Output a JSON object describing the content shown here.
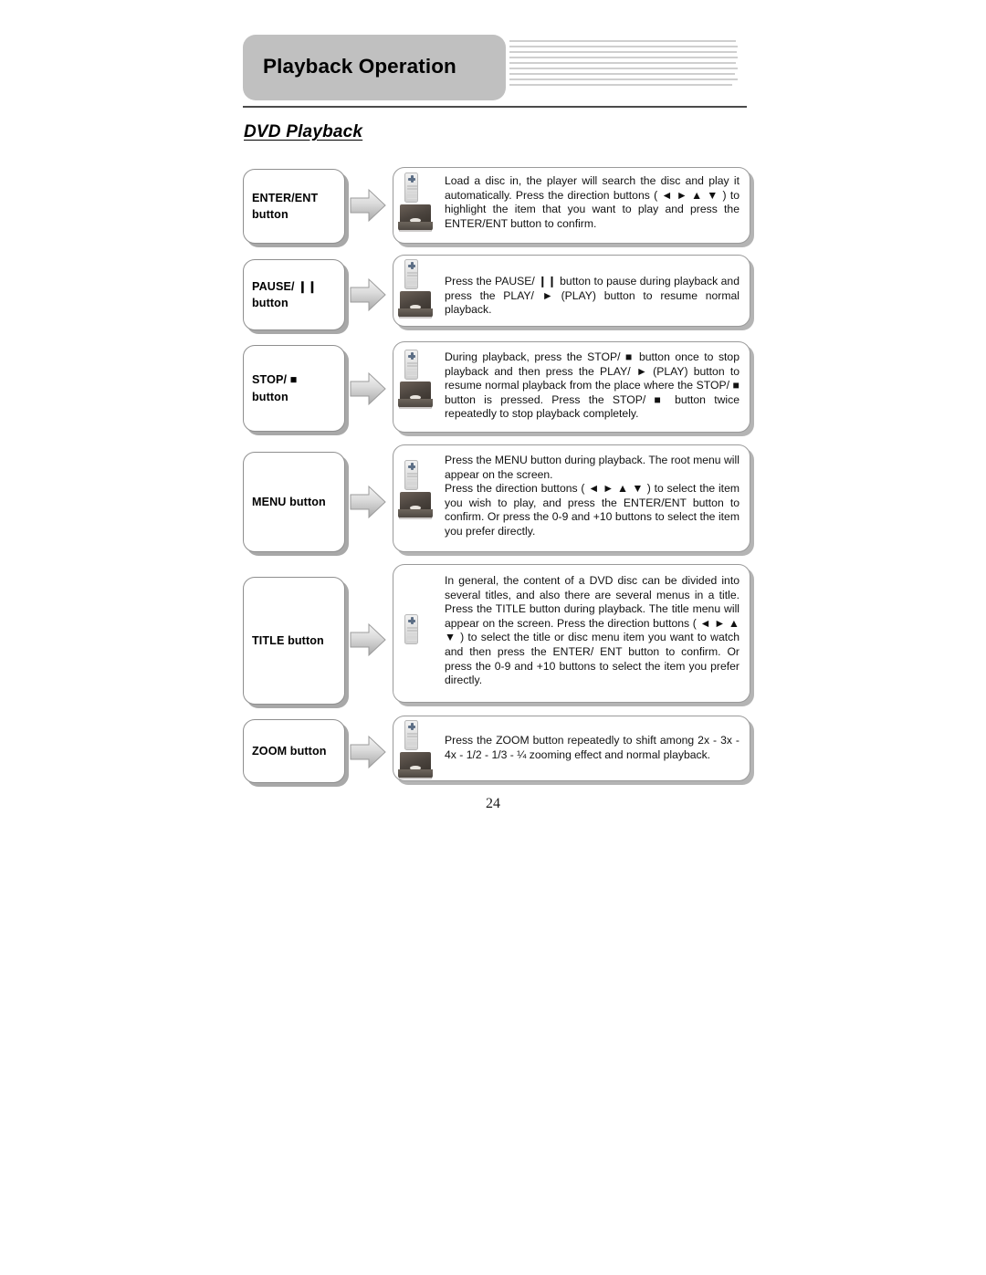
{
  "header": {
    "title": "Playback Operation",
    "stripe_count": 9
  },
  "section": {
    "heading": "DVD Playback"
  },
  "rows": [
    {
      "label": "ENTER/ENT button",
      "label_line1": "ENTER/ENT",
      "label_line2": "button",
      "icons": [
        "remote-icon",
        "dvd-player-icon"
      ],
      "text": "Load a disc in, the player will search the disc and play it automatically. Press the direction buttons ( ◄ ► ▲ ▼ ) to highlight the item that you want to play and press the ENTER/ENT button to confirm."
    },
    {
      "label": "PAUSE/ ❙❙ button",
      "label_line1": "PAUSE/ ❙❙",
      "label_line2": "button",
      "icons": [
        "remote-icon",
        "dvd-player-icon"
      ],
      "text": "Press the PAUSE/ ❙❙ button to pause during playback and press the PLAY/ ► (PLAY) button to resume normal playback."
    },
    {
      "label": "STOP/ ■ button",
      "label_line1": "STOP/ ■ button",
      "label_line2": "",
      "icons": [
        "remote-icon",
        "dvd-player-icon"
      ],
      "text": "During playback, press the STOP/ ■ button once to stop playback and then press the PLAY/ ► (PLAY) button to resume normal playback from the place where the STOP/ ■ button is pressed. Press the STOP/ ■ button twice repeatedly to stop playback completely."
    },
    {
      "label": "MENU button",
      "label_line1": "MENU button",
      "label_line2": "",
      "icons": [
        "remote-icon",
        "dvd-player-icon"
      ],
      "text": "Press the MENU button during playback. The root menu will appear on the screen.",
      "text2": "Press the direction buttons ( ◄ ► ▲ ▼ ) to select the item you wish to play, and press the ENTER/ENT button to confirm. Or press the 0-9 and +10 buttons to select the item you prefer directly."
    },
    {
      "label": "TITLE button",
      "label_line1": "TITLE button",
      "label_line2": "",
      "icons": [
        "remote-icon"
      ],
      "text": "In general, the content of a DVD disc can be divided into several titles, and also there are several menus in a title. Press the TITLE button during playback. The title menu will appear on the screen. Press the direction buttons ( ◄ ► ▲ ▼ ) to select the title or disc menu item you want to watch and then press the ENTER/ ENT button to confirm. Or press the 0-9 and +10 buttons to select the item you prefer directly."
    },
    {
      "label": "ZOOM button",
      "label_line1": "ZOOM button",
      "label_line2": "",
      "icons": [
        "remote-icon",
        "dvd-player-icon"
      ],
      "text": "Press the ZOOM button repeatedly to shift among 2x - 3x - 4x - 1/2 - 1/3 - ¼ zooming effect and normal playback."
    }
  ],
  "footer": {
    "page_number": "24"
  },
  "colors": {
    "header_chip": "#c0c0c0",
    "stripe": "#cfcfcf",
    "rule": "#4a4a4a",
    "box_border": "#8f8f8f",
    "box_shadow": "#a8a8a8",
    "arrow_fill": "#d9d9d9"
  }
}
